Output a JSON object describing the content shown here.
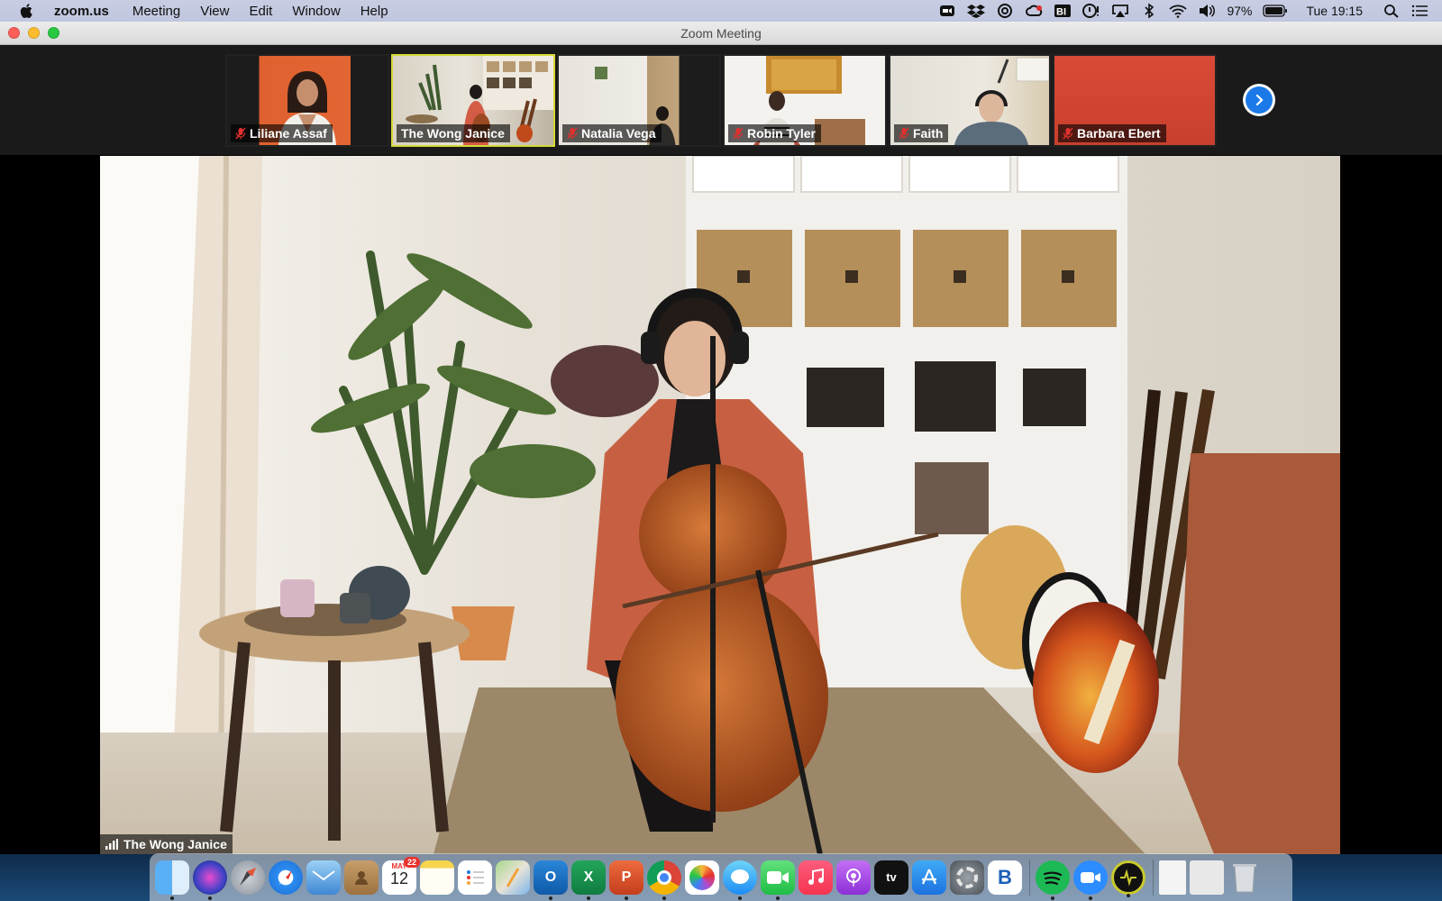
{
  "menubar": {
    "app_name": "zoom.us",
    "items": [
      "Meeting",
      "View",
      "Edit",
      "Window",
      "Help"
    ],
    "battery": "97%",
    "clock": "Tue 19:15"
  },
  "window": {
    "title": "Zoom Meeting"
  },
  "participants": [
    {
      "name": "Liliane Assaf",
      "muted": true
    },
    {
      "name": "The Wong Janice",
      "muted": false,
      "active": true
    },
    {
      "name": "Natalia Vega",
      "muted": true
    },
    {
      "name": "Robin Tyler",
      "muted": true
    },
    {
      "name": "Faith",
      "muted": true
    },
    {
      "name": "Barbara Ebert",
      "muted": true
    }
  ],
  "main_video": {
    "speaker": "The Wong Janice"
  },
  "colors": {
    "active_border": "#d6d936",
    "zoom_blue": "#1b7ae8",
    "mute_red": "#e0312e"
  },
  "dock": {
    "calendar_month": "MAY",
    "calendar_day": "12",
    "calendar_badge": "22",
    "outlook_letter": "O",
    "excel_letter": "X",
    "powerpoint_letter": "P",
    "appletv_label": "tv",
    "bbedit_letter": "B"
  }
}
